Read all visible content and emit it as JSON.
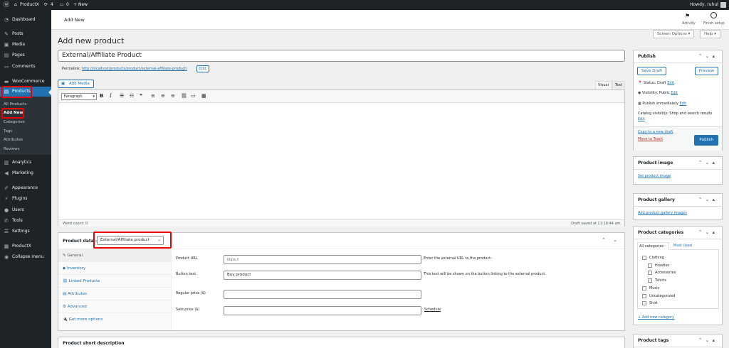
{
  "adminbar": {
    "site_name": "ProductX",
    "updates_count": "4",
    "comments_count": "0",
    "new_label": "New",
    "howdy": "Howdy, ruhul"
  },
  "menu": {
    "items": [
      {
        "label": "Dashboard",
        "icon": "dashboard-icon"
      },
      {
        "label": "Posts",
        "icon": "pin-icon"
      },
      {
        "label": "Media",
        "icon": "media-icon"
      },
      {
        "label": "Pages",
        "icon": "page-icon"
      },
      {
        "label": "Comments",
        "icon": "comment-icon"
      },
      {
        "label": "WooCommerce",
        "icon": "woocommerce-icon"
      },
      {
        "label": "Products",
        "icon": "products-icon"
      },
      {
        "label": "Analytics",
        "icon": "chart-icon"
      },
      {
        "label": "Marketing",
        "icon": "megaphone-icon"
      },
      {
        "label": "Appearance",
        "icon": "brush-icon"
      },
      {
        "label": "Plugins",
        "icon": "plug-icon"
      },
      {
        "label": "Users",
        "icon": "user-icon"
      },
      {
        "label": "Tools",
        "icon": "wrench-icon"
      },
      {
        "label": "Settings",
        "icon": "settings-icon"
      },
      {
        "label": "ProductX",
        "icon": "productx-icon"
      },
      {
        "label": "Collapse menu",
        "icon": "collapse-icon"
      }
    ],
    "submenu": [
      "All Products",
      "Add New",
      "Categories",
      "Tags",
      "Attributes",
      "Reviews"
    ]
  },
  "topnav": {
    "title": "Add New",
    "activity": "Activity",
    "finish_setup": "Finish setup"
  },
  "screen_options": "Screen Options ▾",
  "help": "Help ▾",
  "page_title": "Add new product",
  "product_title": "External/Affiliate Product",
  "permalink": {
    "label": "Permalink:",
    "url": "http://localhost/products/product/external-affiliate-product/",
    "edit": "Edit"
  },
  "editor": {
    "add_media": "Add Media",
    "tab_visual": "Visual",
    "tab_text": "Text",
    "format": "Paragraph",
    "word_count": "Word count: 0",
    "draft_saved": "Draft saved at 11:19:44 am."
  },
  "product_data": {
    "label": "Product data —",
    "type": "External/Affiliate product",
    "tabs": [
      "General",
      "Inventory",
      "Linked Products",
      "Attributes",
      "Advanced",
      "Get more options"
    ],
    "fields": {
      "product_url_label": "Product URL",
      "product_url_placeholder": "https://",
      "product_url_help": "Enter the external URL to the product.",
      "button_text_label": "Button text",
      "button_text_value": "Buy product",
      "button_text_help": "This text will be shown on the button linking to the external product.",
      "regular_price_label": "Regular price ($)",
      "sale_price_label": "Sale price ($)",
      "schedule": "Schedule"
    }
  },
  "short_description": "Product short description",
  "publish": {
    "title": "Publish",
    "save_draft": "Save Draft",
    "preview": "Preview",
    "status": "Status: Draft",
    "visibility": "Visibility: Public",
    "publish_time": "Publish immediately",
    "edit": "Edit",
    "catalog_visibility": "Catalog visibility: Shop and search results",
    "copy_draft": "Copy to a new draft",
    "trash": "Move to Trash",
    "publish_btn": "Publish"
  },
  "product_image": {
    "title": "Product image",
    "link": "Set product image"
  },
  "product_gallery": {
    "title": "Product gallery",
    "link": "Add product gallery images"
  },
  "categories": {
    "title": "Product categories",
    "tab_all": "All categories",
    "tab_most": "Most Used",
    "items": [
      "Clothing",
      "Hoodies",
      "Accessories",
      "Tshirts",
      "Music",
      "Uncategorized",
      "Shirt"
    ],
    "add_new": "+ Add new category"
  },
  "product_tags": "Product tags",
  "colors": {
    "admin_bg": "#1d2327",
    "accent": "#2271b1",
    "highlight": "#e00000"
  }
}
